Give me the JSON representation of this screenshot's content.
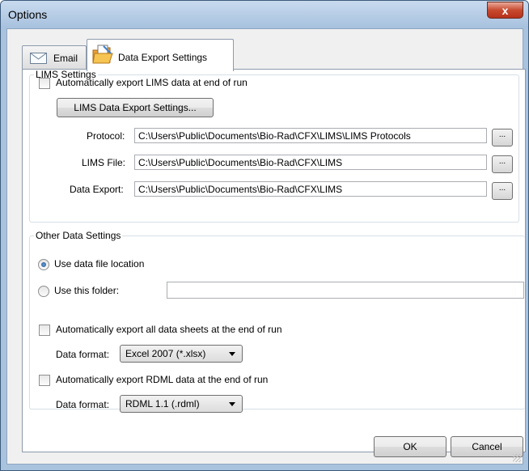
{
  "window": {
    "title": "Options",
    "close_glyph": "x"
  },
  "tabs": [
    {
      "label": "Email",
      "icon": "envelope-icon"
    },
    {
      "label": "Data Export Settings",
      "icon": "folder-icon"
    }
  ],
  "lims": {
    "group_label": "LIMS Settings",
    "auto_export_label": "Automatically export LIMS data at end of run",
    "settings_button": "LIMS Data Export Settings...",
    "fields": [
      {
        "label": "Protocol:",
        "value": "C:\\Users\\Public\\Documents\\Bio-Rad\\CFX\\LIMS\\LIMS Protocols",
        "browse": "..."
      },
      {
        "label": "LIMS File:",
        "value": "C:\\Users\\Public\\Documents\\Bio-Rad\\CFX\\LIMS",
        "browse": "..."
      },
      {
        "label": "Data Export:",
        "value": "C:\\Users\\Public\\Documents\\Bio-Rad\\CFX\\LIMS",
        "browse": "..."
      }
    ]
  },
  "other": {
    "group_label": "Other Data Settings",
    "use_data_location": "Use data file location",
    "use_this_folder": "Use this folder:",
    "folder_value": "",
    "auto_sheets_label": "Automatically export all data sheets at the end of run",
    "data_format_label": "Data format:",
    "sheets_format": "Excel 2007 (*.xlsx)",
    "auto_rdml_label": "Automatically export RDML data at the end of run",
    "rdml_format": "RDML 1.1 (.rdml)"
  },
  "footer": {
    "ok": "OK",
    "cancel": "Cancel"
  },
  "colors": {
    "titlebar": "#b6cce6",
    "close": "#c74a2f",
    "panel": "#ffffff"
  }
}
